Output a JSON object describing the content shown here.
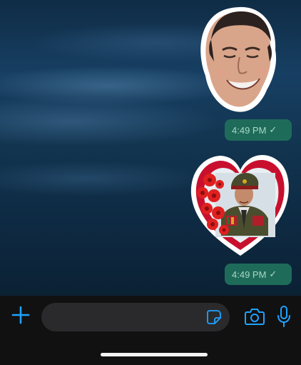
{
  "messages": [
    {
      "type": "sticker",
      "description": "face-sticker",
      "time": "4:49 PM",
      "status": "read"
    },
    {
      "type": "sticker",
      "description": "heart-portrait-sticker",
      "time": "4:49 PM",
      "status": "read"
    }
  ],
  "composer": {
    "placeholder": "",
    "value": ""
  },
  "icons": {
    "plus": "plus-icon",
    "sticker": "sticker-icon",
    "camera": "camera-icon",
    "mic": "microphone-icon",
    "check": "check-icon"
  },
  "colors": {
    "accent": "#1fa2ff",
    "bubble": "#1f6b5a",
    "bubble_text": "#a9d7c6",
    "input_bg": "#2a2a2c"
  }
}
